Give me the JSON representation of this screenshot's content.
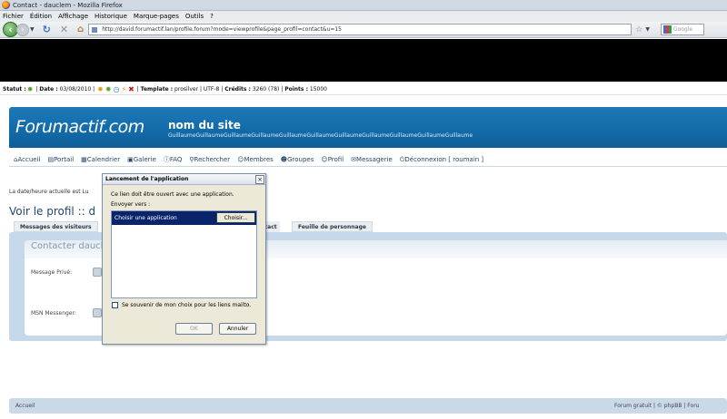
{
  "browser": {
    "window_title": "Contact - dauclem - Mozilla Firefox",
    "menu": [
      "Fichier",
      "Édition",
      "Affichage",
      "Historique",
      "Marque-pages",
      "Outils",
      "?"
    ],
    "url": "http://david.forumactif.lan/profile.forum?mode=viewprofile&page_profil=contact&u=15",
    "search_placeholder": "Google"
  },
  "statusbar": {
    "statut_label": "Statut :",
    "date_label": "Date :",
    "date_value": "03/08/2010",
    "template_label": "Template :",
    "template_value": "prosilver",
    "encoding": "UTF-8",
    "credits_label": "Crédits :",
    "credits_value": "3260 (78)",
    "points_label": "Points :",
    "points_value": "15000"
  },
  "site": {
    "logo": "Forumactif.com",
    "name": "nom du site",
    "description": "GuillaumeGuillaumeGuillaumeGuillaumeGuillaumeGuillaumeGuillaumeGuillaumeGuillaumeGuillaumeGuillaume"
  },
  "nav": [
    "Accueil",
    "Portail",
    "Calendrier",
    "Galerie",
    "FAQ",
    "Rechercher",
    "Membres",
    "Groupes",
    "Profil",
    "Messagerie",
    "Déconnexion [ roumain ]"
  ],
  "page": {
    "datetime_text": "La date/heure actuelle est Lu",
    "title": "Voir le profil :: d",
    "tabs": [
      "Messages des visiteurs",
      "ntact",
      "Feuille de personnage"
    ],
    "contact_title": "Contacter daucl",
    "fields": [
      "Message Privé:",
      "MSN Messenger:"
    ]
  },
  "footer": {
    "left": "Accueil",
    "right": "Forum gratuit  |  ©  phpBB  |  Foru"
  },
  "dialog": {
    "title": "Lancement de l'application",
    "close": "×",
    "message": "Ce lien doit être ouvert avec une application.",
    "send_to": "Envoyer vers :",
    "selected_item": "Choisir une application",
    "choose_button": "Choisir...",
    "remember": "Se souvenir de mon choix pour les liens mailto.",
    "ok": "OK",
    "cancel": "Annuler"
  }
}
